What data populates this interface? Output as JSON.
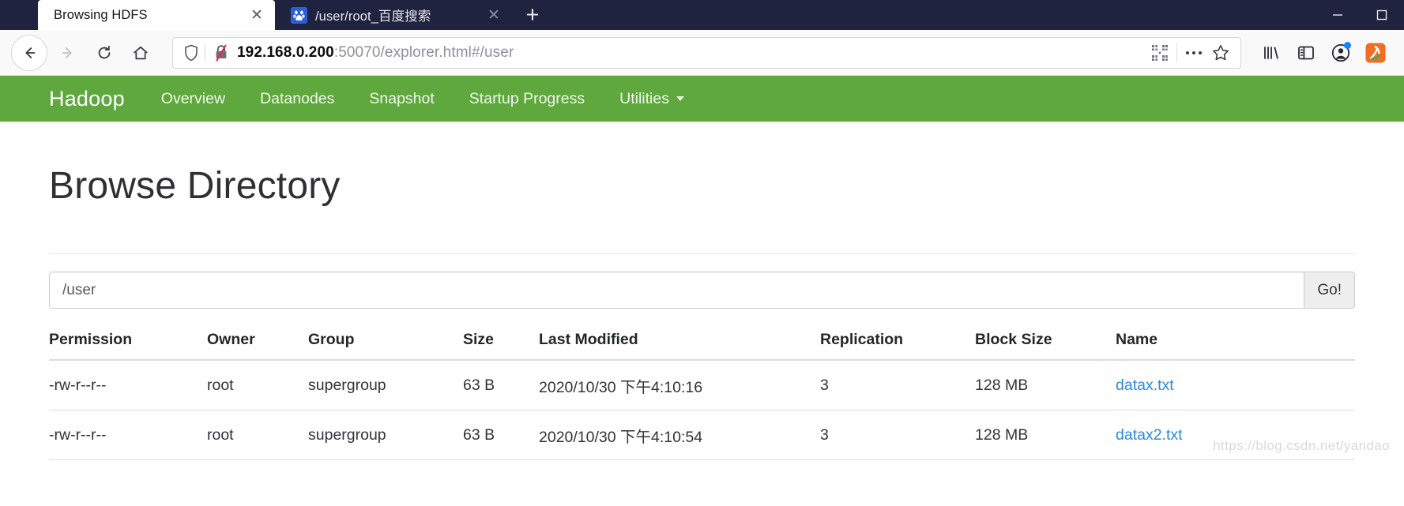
{
  "browser": {
    "tabs": [
      {
        "title": "Browsing HDFS",
        "favicon": "none",
        "active": true,
        "close_label": "✕"
      },
      {
        "title": "/user/root_百度搜索",
        "favicon": "baidu-paw-icon",
        "active": false,
        "close_label": "✕"
      }
    ],
    "new_tab_label": "+",
    "window_controls": {
      "minimize": "─",
      "maximize": "☐",
      "close": "✕"
    },
    "nav": {
      "back_label": "←",
      "forward_label": "→",
      "reload_label": "⟳",
      "home_label": "⌂"
    },
    "url": {
      "host": "192.168.0.200",
      "rest": ":50070/explorer.html#/user",
      "full": "192.168.0.200:50070/explorer.html#/user",
      "shield_icon": "shield-icon",
      "security_icon": "broken-lock-icon",
      "qr_icon": "qr-code-icon",
      "more_icon": "ellipsis-icon",
      "bookmark_icon": "star-icon"
    },
    "toolbar_icons": [
      {
        "name": "library-icon",
        "badge": false
      },
      {
        "name": "sidebar-icon",
        "badge": false
      },
      {
        "name": "account-icon",
        "badge": true
      },
      {
        "name": "extension-icon",
        "badge": false
      }
    ]
  },
  "hadoop": {
    "brand": "Hadoop",
    "nav_items": [
      {
        "label": "Overview",
        "has_caret": false
      },
      {
        "label": "Datanodes",
        "has_caret": false
      },
      {
        "label": "Snapshot",
        "has_caret": false
      },
      {
        "label": "Startup Progress",
        "has_caret": false
      },
      {
        "label": "Utilities",
        "has_caret": true
      }
    ],
    "navbar_color": "#5fa83d",
    "link_color": "#2a8adf",
    "page_title": "Browse Directory",
    "path": {
      "value": "/user",
      "placeholder": "/user",
      "go_label": "Go!"
    },
    "table": {
      "headers": [
        "Permission",
        "Owner",
        "Group",
        "Size",
        "Last Modified",
        "Replication",
        "Block Size",
        "Name"
      ],
      "rows": [
        {
          "permission": "-rw-r--r--",
          "owner": "root",
          "group": "supergroup",
          "size": "63 B",
          "last_modified": "2020/10/30 下午4:10:16",
          "replication": "3",
          "block_size": "128 MB",
          "name": "datax.txt"
        },
        {
          "permission": "-rw-r--r--",
          "owner": "root",
          "group": "supergroup",
          "size": "63 B",
          "last_modified": "2020/10/30 下午4:10:54",
          "replication": "3",
          "block_size": "128 MB",
          "name": "datax2.txt"
        }
      ]
    }
  },
  "watermark": "https://blog.csdn.net/yandao"
}
